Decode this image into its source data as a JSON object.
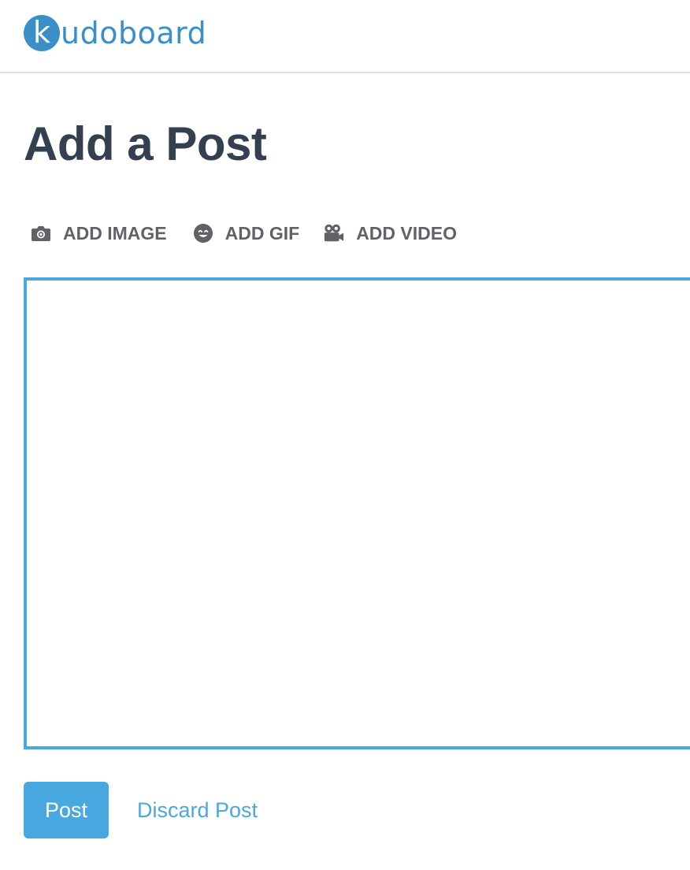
{
  "header": {
    "logo_letter": "k",
    "logo_text": "udoboard",
    "brand_color": "#3b8fc7"
  },
  "page": {
    "title": "Add a Post"
  },
  "media_bar": {
    "image_label": "ADD IMAGE",
    "image_icon": "camera-icon",
    "gif_label": "ADD GIF",
    "gif_icon": "smiley-icon",
    "video_label": "ADD VIDEO",
    "video_icon": "video-camera-icon"
  },
  "editor": {
    "value": "",
    "border_color": "#4aa8e0"
  },
  "actions": {
    "post_label": "Post",
    "discard_label": "Discard Post",
    "accent_color": "#4aa8e0"
  }
}
